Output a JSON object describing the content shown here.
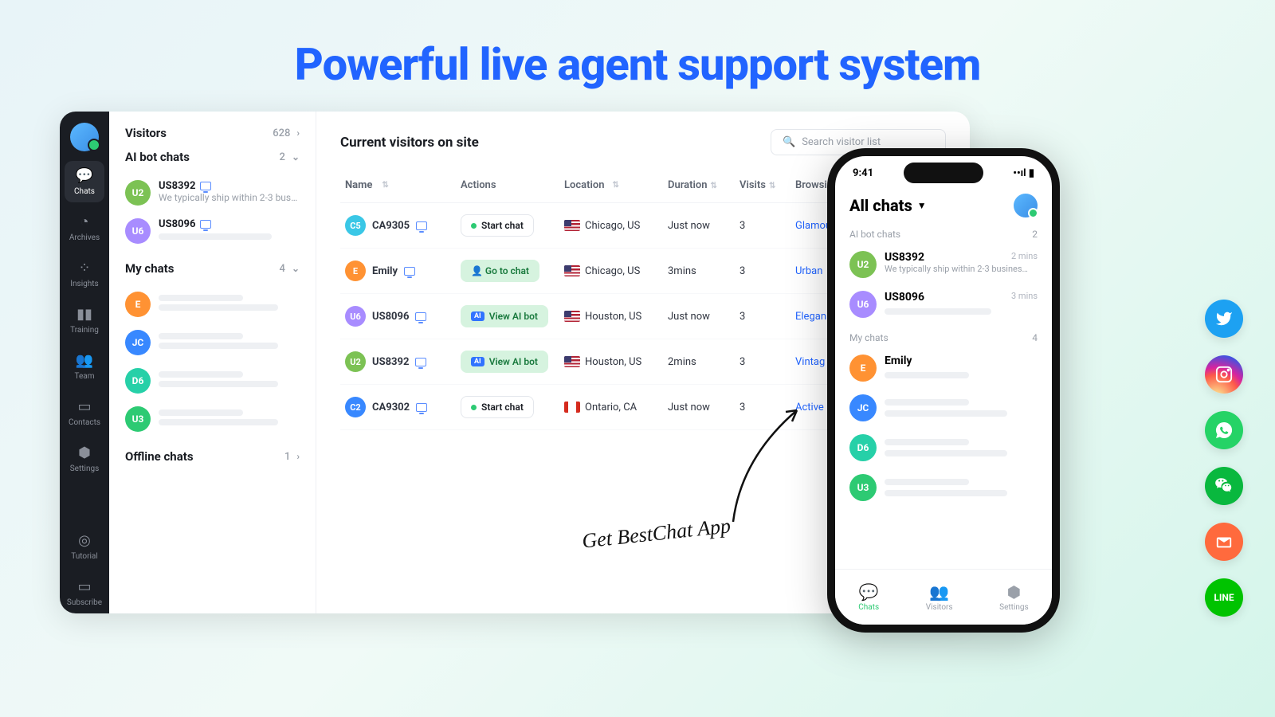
{
  "hero": {
    "title": "Powerful live agent support system"
  },
  "rail": {
    "items": [
      {
        "label": "Chats",
        "active": true
      },
      {
        "label": "Archives",
        "active": false
      },
      {
        "label": "Insights",
        "active": false
      },
      {
        "label": "Training",
        "active": false
      },
      {
        "label": "Team",
        "active": false
      },
      {
        "label": "Contacts",
        "active": false
      },
      {
        "label": "Settings",
        "active": false
      }
    ],
    "bottom": [
      {
        "label": "Tutorial"
      },
      {
        "label": "Subscribe"
      }
    ]
  },
  "convo": {
    "visitors": {
      "title": "Visitors",
      "count": "628"
    },
    "ai_chats": {
      "title": "AI bot chats",
      "count": "2",
      "items": [
        {
          "avatar": "U2",
          "color": "#7cc254",
          "name": "US8392",
          "preview": "We typically ship within 2-3 busi..."
        },
        {
          "avatar": "U6",
          "color": "#a88cff",
          "name": "US8096",
          "preview": ""
        }
      ]
    },
    "my_chats": {
      "title": "My chats",
      "count": "4",
      "items": [
        {
          "avatar": "E",
          "color": "#ff9233",
          "name": ""
        },
        {
          "avatar": "JC",
          "color": "#3888ff",
          "name": ""
        },
        {
          "avatar": "D6",
          "color": "#26d0a8",
          "name": ""
        },
        {
          "avatar": "U3",
          "color": "#2dca73",
          "name": ""
        }
      ]
    },
    "offline": {
      "title": "Offline chats",
      "count": "1"
    }
  },
  "main": {
    "title": "Current visitors on site",
    "search_placeholder": "Search visitor list",
    "columns": {
      "name": "Name",
      "actions": "Actions",
      "location": "Location",
      "duration": "Duration",
      "visits": "Visits",
      "browsing": "Browsi"
    },
    "rows": [
      {
        "avatar": "C5",
        "color": "#3ac7e6",
        "name": "CA9305",
        "action": "Start chat",
        "action_style": "plain",
        "loc": "Chicago, US",
        "flag": "us",
        "dur": "Just now",
        "visits": "3",
        "browse": "Glamou"
      },
      {
        "avatar": "E",
        "color": "#ff9233",
        "name": "Emily",
        "action": "Go to chat",
        "action_style": "green",
        "loc": "Chicago, US",
        "flag": "us",
        "dur": "3mins",
        "visits": "3",
        "browse": "Urban"
      },
      {
        "avatar": "U6",
        "color": "#a88cff",
        "name": "US8096",
        "action": "View AI bot",
        "action_style": "ai",
        "loc": "Houston, US",
        "flag": "us",
        "dur": "Just now",
        "visits": "3",
        "browse": "Elegan"
      },
      {
        "avatar": "U2",
        "color": "#7cc254",
        "name": "US8392",
        "action": "View AI bot",
        "action_style": "ai",
        "loc": "Houston, US",
        "flag": "us",
        "dur": "2mins",
        "visits": "3",
        "browse": "Vintag"
      },
      {
        "avatar": "C2",
        "color": "#3888ff",
        "name": "CA9302",
        "action": "Start chat",
        "action_style": "plain",
        "loc": "Ontario, CA",
        "flag": "ca",
        "dur": "Just now",
        "visits": "3",
        "browse": "Active"
      }
    ]
  },
  "phone": {
    "time": "9:41",
    "title": "All chats",
    "sect_ai": {
      "label": "AI bot chats",
      "count": "2"
    },
    "sect_my": {
      "label": "My chats",
      "count": "4"
    },
    "ai_items": [
      {
        "avatar": "U2",
        "color": "#7cc254",
        "name": "US8392",
        "time": "2 mins",
        "preview": "We typically ship within 2-3 business days..."
      },
      {
        "avatar": "U6",
        "color": "#a88cff",
        "name": "US8096",
        "time": "3 mins",
        "preview": ""
      }
    ],
    "my_items": [
      {
        "avatar": "E",
        "color": "#ff9233",
        "name": "Emily"
      },
      {
        "avatar": "JC",
        "color": "#3888ff",
        "name": ""
      },
      {
        "avatar": "D6",
        "color": "#26d0a8",
        "name": ""
      },
      {
        "avatar": "U3",
        "color": "#2dca73",
        "name": ""
      }
    ],
    "tabs": [
      {
        "label": "Chats",
        "active": true
      },
      {
        "label": "Visitors",
        "active": false
      },
      {
        "label": "Settings",
        "active": false
      }
    ]
  },
  "callout": {
    "text": "Get BestChat App"
  },
  "socials": [
    {
      "name": "twitter"
    },
    {
      "name": "instagram"
    },
    {
      "name": "whatsapp"
    },
    {
      "name": "wechat"
    },
    {
      "name": "mail"
    },
    {
      "name": "line"
    }
  ]
}
